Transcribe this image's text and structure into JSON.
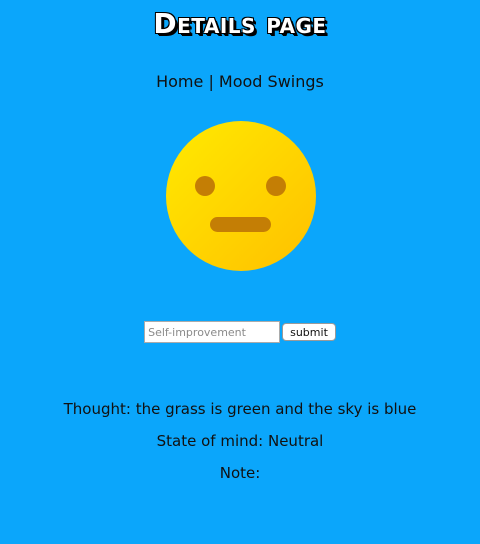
{
  "page": {
    "title": "Details page"
  },
  "nav": {
    "home_label": "Home",
    "separator": " | ",
    "current_label": "Mood Swings"
  },
  "mood_icon": {
    "name": "neutral-face-icon",
    "colors": {
      "face_light": "#ffe600",
      "face_dark": "#ffc200",
      "features": "#c47e05"
    }
  },
  "form": {
    "input_value": "",
    "input_placeholder": "Self-improvement",
    "submit_label": "submit"
  },
  "details": {
    "thought_label": "Thought:",
    "thought_value": "the grass is green and the sky is blue",
    "state_label": "State of mind:",
    "state_value": "Neutral",
    "note_label": "Note:",
    "note_value": ""
  },
  "colors": {
    "background": "#0ba6fb"
  }
}
